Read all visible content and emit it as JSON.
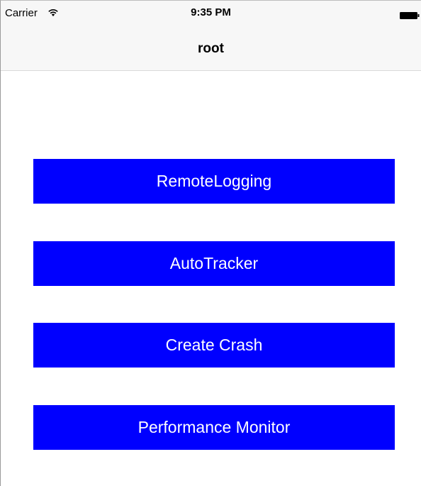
{
  "status_bar": {
    "carrier": "Carrier",
    "time": "9:35 PM",
    "wifi_icon": "wifi-icon",
    "battery_icon": "battery-icon"
  },
  "nav_bar": {
    "title": "root"
  },
  "buttons": [
    {
      "label": "RemoteLogging",
      "color": "#0000ff"
    },
    {
      "label": "AutoTracker",
      "color": "#0000ff"
    },
    {
      "label": "Create Crash",
      "color": "#0000ff"
    },
    {
      "label": "Performance Monitor",
      "color": "#0000ff"
    }
  ],
  "colors": {
    "button_background": "#0000ff",
    "button_text": "#ffffff",
    "bar_background": "#f7f7f7"
  }
}
